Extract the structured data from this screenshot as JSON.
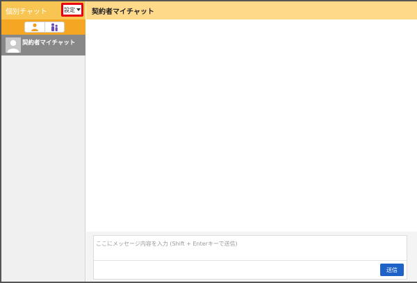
{
  "sidebar": {
    "title": "個別チャット",
    "settings_label": "設定",
    "filter_buttons": [
      {
        "icon": "person-icon"
      },
      {
        "icon": "group-icon"
      }
    ],
    "contacts": [
      {
        "name": "契約者マイチャット",
        "icon": "avatar-icon"
      }
    ]
  },
  "main": {
    "title": "契約者マイチャット"
  },
  "composer": {
    "placeholder": "ここにメッセージ内容を入力 (Shift + Enterキーで送信)",
    "value": "",
    "send_label": "送信"
  },
  "colors": {
    "sidebar_header": "#f9c552",
    "filter_bar": "#f5a623",
    "main_header": "#ffd98a",
    "selected_contact": "#888888",
    "settings_highlight": "#e60012",
    "send_button": "#1e62c8"
  }
}
